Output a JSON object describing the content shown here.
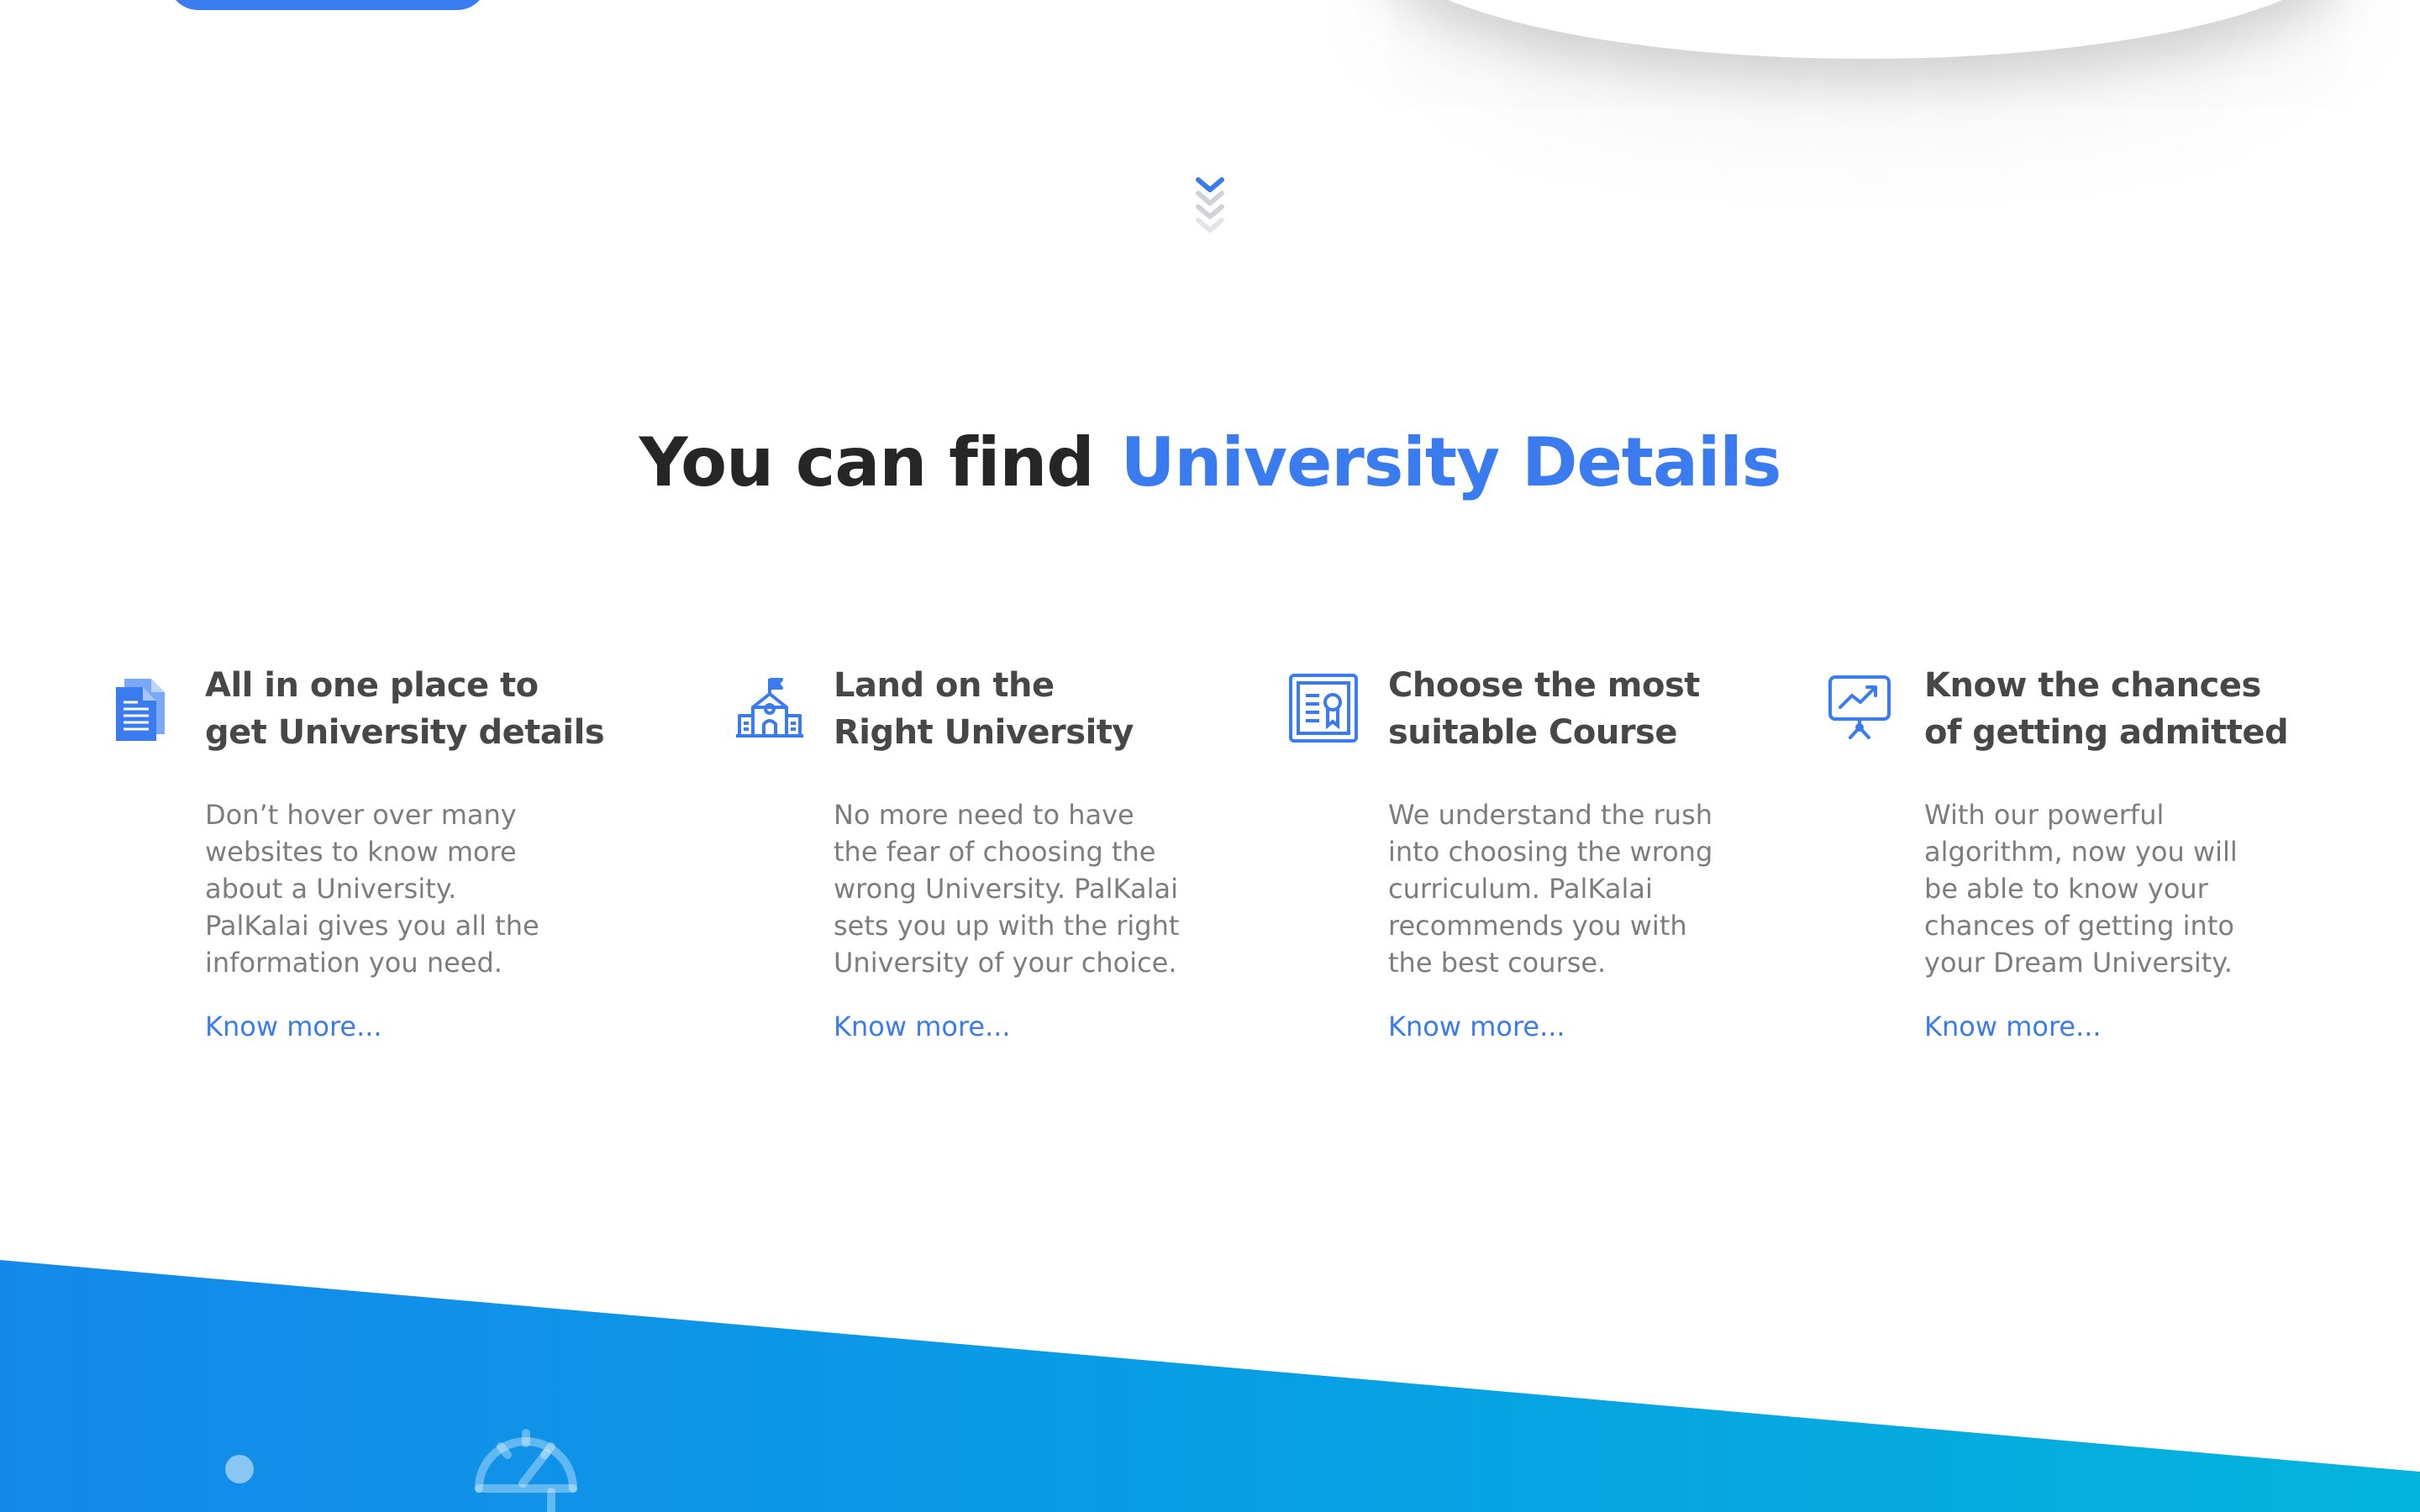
{
  "headline": {
    "prefix": "You can find",
    "highlight": "University Details"
  },
  "features": [
    {
      "icon": "document-icon",
      "title_lines": [
        "All in one place to",
        "get University details"
      ],
      "desc_lines": [
        "Don’t hover over many",
        "websites to know more",
        "about a University.",
        "PalKalai gives you all the",
        "information you need."
      ],
      "link": "Know more..."
    },
    {
      "icon": "school-building-icon",
      "title_lines": [
        "Land on the",
        "Right University"
      ],
      "desc_lines": [
        "No more need to have",
        "the fear of choosing the",
        "wrong University. PalKalai",
        "sets you up with the right",
        "University of your choice."
      ],
      "link": "Know more..."
    },
    {
      "icon": "certificate-icon",
      "title_lines": [
        "Choose the most",
        "suitable Course"
      ],
      "desc_lines": [
        "We understand the rush",
        "into choosing the wrong",
        "curriculum. PalKalai",
        "recommends you with",
        "the best course."
      ],
      "link": "Know more..."
    },
    {
      "icon": "presentation-chart-icon",
      "title_lines": [
        "Know the chances",
        "of getting admitted"
      ],
      "desc_lines": [
        "With our powerful",
        "algorithm, now you will",
        "be able to know your",
        "chances of getting into",
        "your Dream University."
      ],
      "link": "Know more..."
    }
  ],
  "colors": {
    "accent": "#3a7bf0",
    "heading": "#262626",
    "title": "#474747",
    "body": "#7d7d7d",
    "band_start": "#1489ea",
    "band_end": "#04b4dc"
  }
}
